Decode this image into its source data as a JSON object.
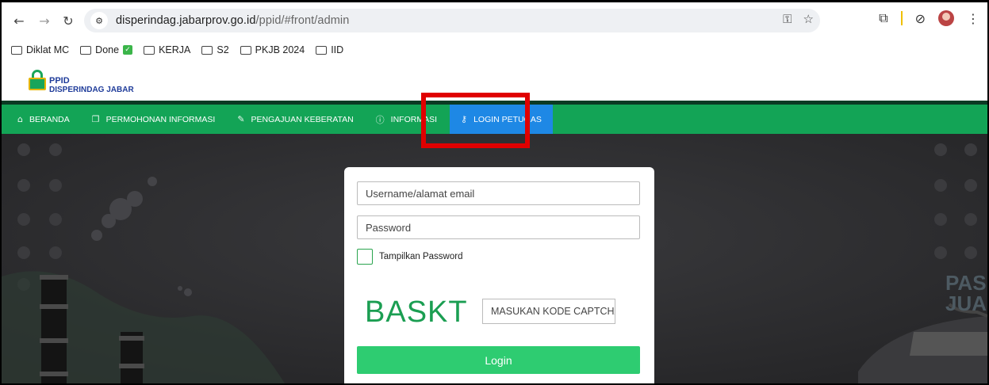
{
  "browser": {
    "url_host": "disperindag.jabarprov.go.id",
    "url_path": "/ppid/#front/admin",
    "bookmarks": [
      {
        "label": "Diklat MC"
      },
      {
        "label": "Done"
      },
      {
        "label": "KERJA"
      },
      {
        "label": "S2"
      },
      {
        "label": "PKJB 2024"
      },
      {
        "label": "IID"
      }
    ]
  },
  "site": {
    "logo_line1": "PPID",
    "logo_line2": "DISPERINDAG JABAR"
  },
  "nav": {
    "items": [
      {
        "label": "BERANDA",
        "icon": "home-icon"
      },
      {
        "label": "PERMOHONAN INFORMASI",
        "icon": "document-icon"
      },
      {
        "label": "PENGAJUAN KEBERATAN",
        "icon": "edit-icon"
      },
      {
        "label": "INFORMASI",
        "icon": "info-icon"
      },
      {
        "label": "LOGIN PETUGAS",
        "icon": "key-icon"
      }
    ]
  },
  "login": {
    "username_placeholder": "Username/alamat email",
    "password_placeholder": "Password",
    "show_password_label": "Tampilkan Password",
    "captcha_text": "BASKT",
    "captcha_placeholder": "MASUKAN KODE CAPTCHA",
    "login_label": "Login"
  },
  "hero": {
    "sign_line1": "PAS",
    "sign_line2": "JUA"
  },
  "colors": {
    "nav_green": "#13a456",
    "active_blue": "#1e88e5",
    "button_green": "#2ecc71",
    "highlight_red": "#e00000"
  }
}
